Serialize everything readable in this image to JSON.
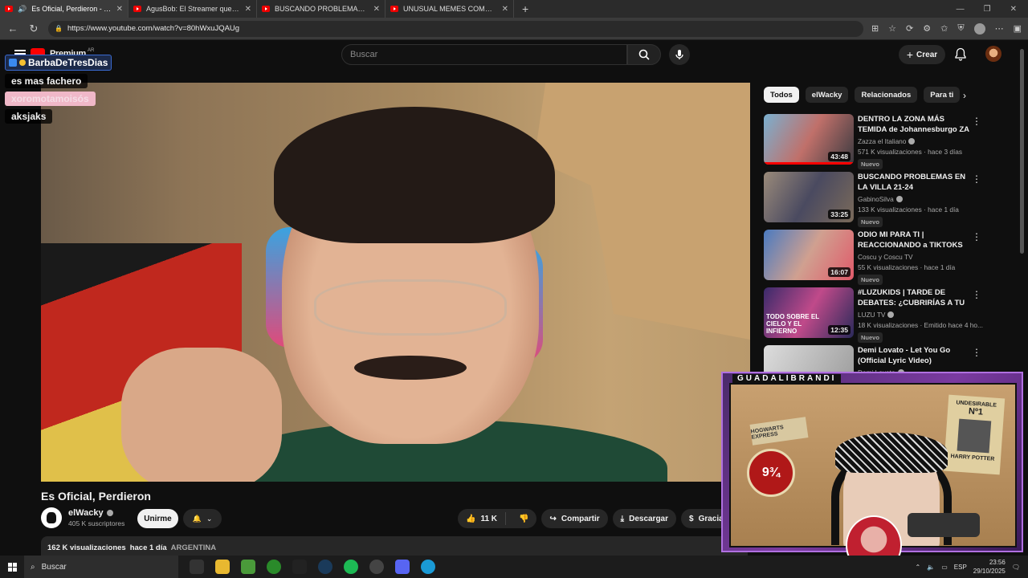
{
  "browser": {
    "tabs": [
      {
        "title": "Es Oficial, Perdieron - YouTube",
        "active": true,
        "audio": true
      },
      {
        "title": "AgusBob: El Streamer que ARRUINÓ",
        "active": false
      },
      {
        "title": "BUSCANDO PROBLEMAS EN LA VILLA",
        "active": false
      },
      {
        "title": "UNUSUAL MEMES COMPILATION",
        "active": false
      }
    ],
    "url": "https://www.youtube.com/watch?v=80hWxuJQAUg"
  },
  "youtube": {
    "logo_text": "Premium",
    "region": "AR",
    "search_placeholder": "Buscar",
    "create_label": "Crear"
  },
  "chat_overlay": {
    "user": "BarbaDeTresDias",
    "messages": [
      "es mas fachero",
      "xoromotamoisós",
      "aksjaks"
    ]
  },
  "video": {
    "title": "Es Oficial, Perdieron",
    "channel": "elWacky",
    "subscribers": "405 K suscriptores",
    "join_label": "Unirme",
    "likes": "11 K",
    "share_label": "Compartir",
    "download_label": "Descargar",
    "thanks_label": "Gracias",
    "views": "162 K visualizaciones",
    "age": "hace 1 día",
    "country": "ARGENTINA"
  },
  "chips": [
    "Todos",
    "elWacky",
    "Relacionados",
    "Para ti"
  ],
  "recommendations": [
    {
      "title": "DENTRO LA ZONA MÁS TEMIDA de Johannesburgo ZA ...",
      "channel": "Zazza el Italiano",
      "meta": "571 K visualizaciones · hace 3 días",
      "duration": "43:48",
      "badge": "Nuevo",
      "progress": 1.0
    },
    {
      "title": "BUSCANDO PROBLEMAS EN LA VILLA 21-24",
      "channel": "GabinoSilva",
      "meta": "133 K visualizaciones · hace 1 día",
      "duration": "33:25",
      "badge": "Nuevo",
      "progress": 0
    },
    {
      "title": "ODIO MI PARA TI | REACCIONANDO a TIKTOKS",
      "channel": "Coscu y Coscu TV",
      "meta": "55 K visualizaciones · hace 1 día",
      "duration": "16:07",
      "badge": "Nuevo",
      "progress": 0
    },
    {
      "title": "#LUZUKIDS | TARDE DE DEBATES: ¿CUBRIRÍAS A TU ...",
      "channel": "LUZU TV",
      "meta": "18 K visualizaciones · Emitido hace 4 ho...",
      "duration": "12:35",
      "badge": "Nuevo",
      "progress": 0
    },
    {
      "title": "Demi Lovato - Let You Go (Official Lyric Video)",
      "channel": "Demi Lovato",
      "meta": "",
      "duration": "",
      "badge": "",
      "progress": 0
    }
  ],
  "thumb_text": {
    "luzu": "TODO SOBRE EL CIELO Y EL INFIERNO"
  },
  "webcam": {
    "streamer": "GUADALIBRANDI",
    "sign_platform": "9¾",
    "sign_platform_label": "PLATFORM",
    "sign_hogwarts": "HOGWARTS EXPRESS",
    "poster_top": "UNDESIRABLE",
    "poster_no": "Nº1",
    "poster_name": "HARRY POTTER"
  },
  "taskbar": {
    "search_placeholder": "Buscar",
    "lang": "ESP",
    "time": "23:56",
    "date": "29/10/2025"
  }
}
